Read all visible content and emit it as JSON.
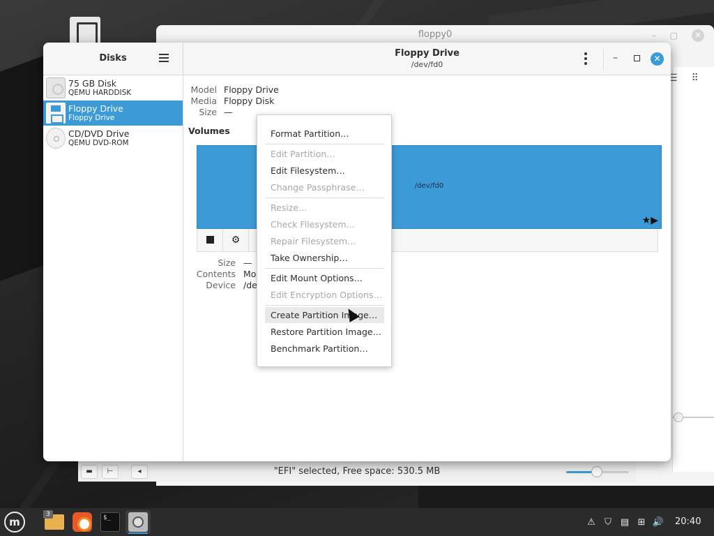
{
  "background_window": {
    "title": "floppy0",
    "status_text": "\"EFI\" selected, Free space: 530.5 MB"
  },
  "sidebar": {
    "title": "Disks",
    "disks": [
      {
        "name": "75 GB Disk",
        "sub": "QEMU HARDDISK",
        "icon": "harddisk-icon"
      },
      {
        "name": "Floppy Drive",
        "sub": "Floppy Drive",
        "icon": "floppy-icon",
        "selected": true
      },
      {
        "name": "CD/DVD Drive",
        "sub": "QEMU DVD-ROM",
        "icon": "optical-drive-icon"
      }
    ]
  },
  "header": {
    "title": "Floppy Drive",
    "subtitle": "/dev/fd0"
  },
  "drive_info": {
    "model_label": "Model",
    "model_value": "Floppy Drive",
    "media_label": "Media",
    "media_value": "Floppy Disk",
    "size_label": "Size",
    "size_value": "—"
  },
  "volumes": {
    "title": "Volumes",
    "bar_label": "/dev/fd0",
    "size_label": "Size",
    "size_value": "—",
    "contents_label": "Contents",
    "contents_value": "Mo",
    "device_label": "Device",
    "device_value": "/de"
  },
  "context_menu": {
    "items": [
      {
        "label": "Format Partition…",
        "enabled": true
      },
      {
        "label": "Edit Partition…",
        "enabled": false
      },
      {
        "label": "Edit Filesystem…",
        "enabled": true
      },
      {
        "label": "Change Passphrase…",
        "enabled": false
      },
      {
        "label": "Resize…",
        "enabled": false
      },
      {
        "label": "Check Filesystem…",
        "enabled": false
      },
      {
        "label": "Repair Filesystem…",
        "enabled": false
      },
      {
        "label": "Take Ownership…",
        "enabled": true
      },
      {
        "label": "Edit Mount Options…",
        "enabled": true
      },
      {
        "label": "Edit Encryption Options…",
        "enabled": false
      },
      {
        "label": "Create Partition Image…",
        "enabled": true,
        "hovered": true
      },
      {
        "label": "Restore Partition Image…",
        "enabled": true
      },
      {
        "label": "Benchmark Partition…",
        "enabled": true
      }
    ]
  },
  "taskbar": {
    "folder_badge": "3",
    "clock": "20:40",
    "terminal_glyph": "$_"
  },
  "colors": {
    "accent": "#3c9bd6",
    "taskbar": "#2b2b2b"
  }
}
